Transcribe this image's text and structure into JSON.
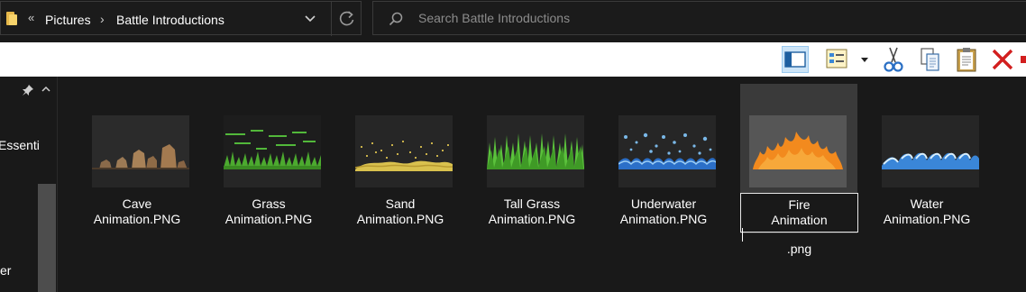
{
  "address_bar": {
    "overflow_glyph": "«",
    "crumbs": [
      "Pictures",
      "Battle Introductions"
    ],
    "separator": "›"
  },
  "search": {
    "placeholder": "Search Battle Introductions"
  },
  "navpane": {
    "items": [
      "Essenti",
      "er"
    ]
  },
  "files": [
    {
      "line1": "Cave",
      "line2": "Animation.PNG",
      "thumb": "cave"
    },
    {
      "line1": "Grass",
      "line2": "Animation.PNG",
      "thumb": "grass"
    },
    {
      "line1": "Sand",
      "line2": "Animation.PNG",
      "thumb": "sand"
    },
    {
      "line1": "Tall Grass",
      "line2": "Animation.PNG",
      "thumb": "tall-grass"
    },
    {
      "line1": "Underwater",
      "line2": "Animation.PNG",
      "thumb": "underwater"
    },
    {
      "line1": "Fire",
      "line2_before_caret": "Animation",
      "line2_after_caret": ".png",
      "thumb": "fire",
      "selected": true,
      "renaming": true
    },
    {
      "line1": "Water",
      "line2": "Animation.PNG",
      "thumb": "water"
    }
  ],
  "colors": {
    "background": "#191919",
    "toolbar": "#ffffff",
    "selected_item": "#3a3a3a",
    "accent_panes": "#cce4f7",
    "delete_red": "#d21f1f",
    "folder_yellow": "#f7d36b"
  }
}
